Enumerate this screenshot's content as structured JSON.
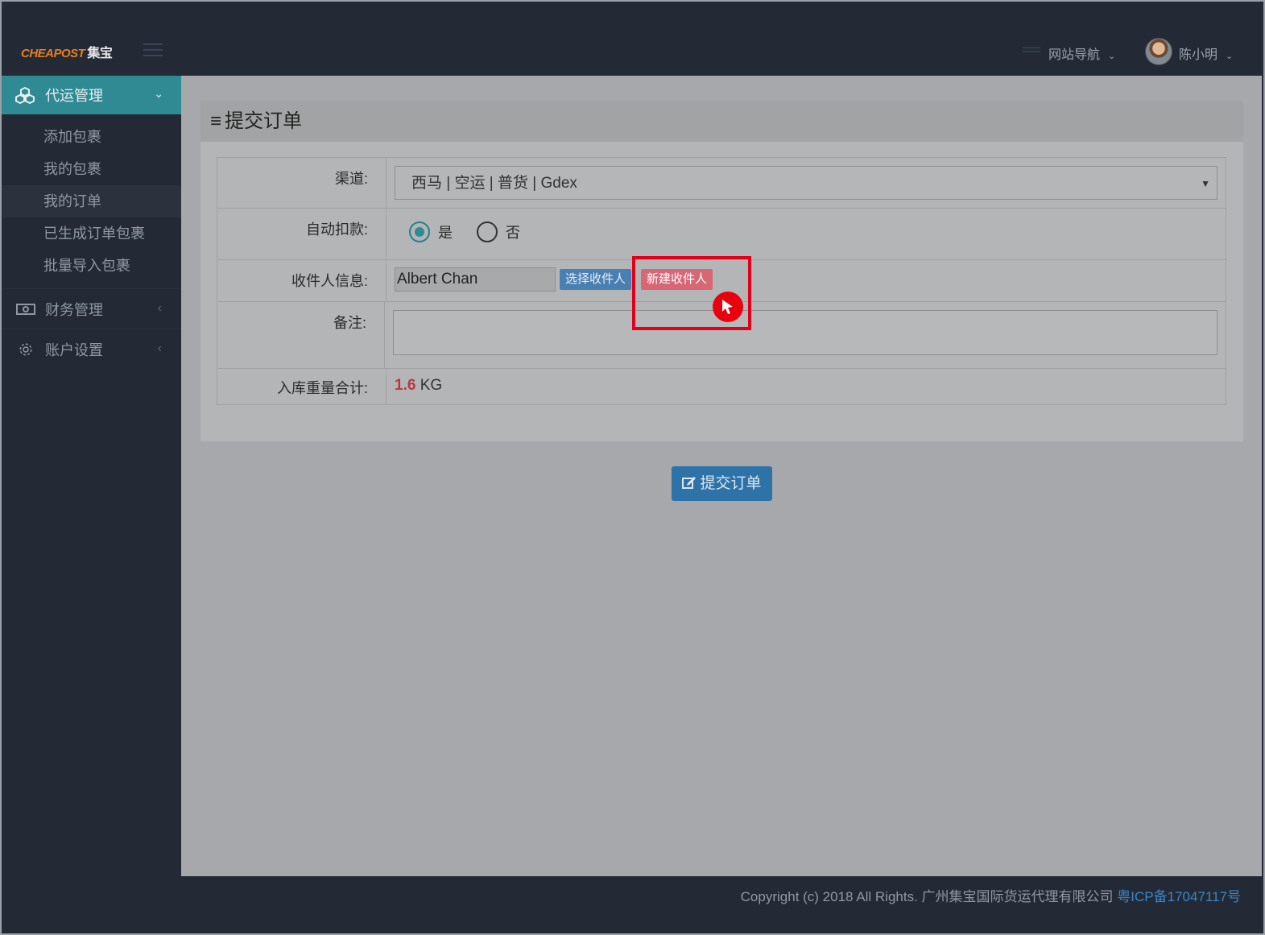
{
  "brand": {
    "logo_en": "CHEAPOST",
    "logo_cn": "集宝"
  },
  "topnav": {
    "site_nav": "网站导航",
    "user_name": "陈小明"
  },
  "sidebar": {
    "section1": {
      "label": "代运管理",
      "items": [
        "添加包裹",
        "我的包裹",
        "我的订单",
        "已生成订单包裹",
        "批量导入包裹"
      ]
    },
    "section2": {
      "label": "财务管理"
    },
    "section3": {
      "label": "账户设置"
    }
  },
  "panel": {
    "title": "提交订单"
  },
  "form": {
    "channel_label": "渠道:",
    "channel_value": "西马 | 空运 | 普货 | Gdex",
    "autopay_label": "自动扣款:",
    "autopay_yes": "是",
    "autopay_no": "否",
    "receiver_label": "收件人信息:",
    "receiver_value": "Albert Chan",
    "select_receiver": "选择收件人",
    "new_receiver": "新建收件人",
    "remark_label": "备注:",
    "weight_label": "入库重量合计:",
    "weight_value": "1.6",
    "weight_unit": "KG"
  },
  "submit_label": "提交订单",
  "footer": {
    "copyright": "Copyright (c) 2018 All Rights. 广州集宝国际货运代理有限公司",
    "icp": "粤ICP备17047117号"
  },
  "colors": {
    "accent": "#2f8a93",
    "highlight": "#e0001a",
    "submit": "#2d73a8"
  }
}
